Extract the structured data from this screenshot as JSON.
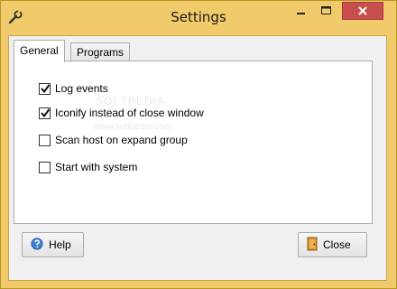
{
  "window": {
    "title": "Settings",
    "accent_color": "#f1cb6b",
    "close_button_color": "#c7504f"
  },
  "tabs": [
    {
      "label": "General",
      "selected": true
    },
    {
      "label": "Programs",
      "selected": false
    }
  ],
  "options": [
    {
      "label": "Log events",
      "checked": true
    },
    {
      "label": "Iconify instead of close window",
      "checked": true
    },
    {
      "label": "Scan host on expand group",
      "checked": false
    },
    {
      "label": "Start with system",
      "checked": false
    }
  ],
  "watermark": {
    "logo": "SOFTPEDIA",
    "url": "www.softpedia.com"
  },
  "buttons": {
    "help_label": "Help",
    "help_icon": "help-icon",
    "close_label": "Close",
    "close_icon": "door-icon"
  }
}
